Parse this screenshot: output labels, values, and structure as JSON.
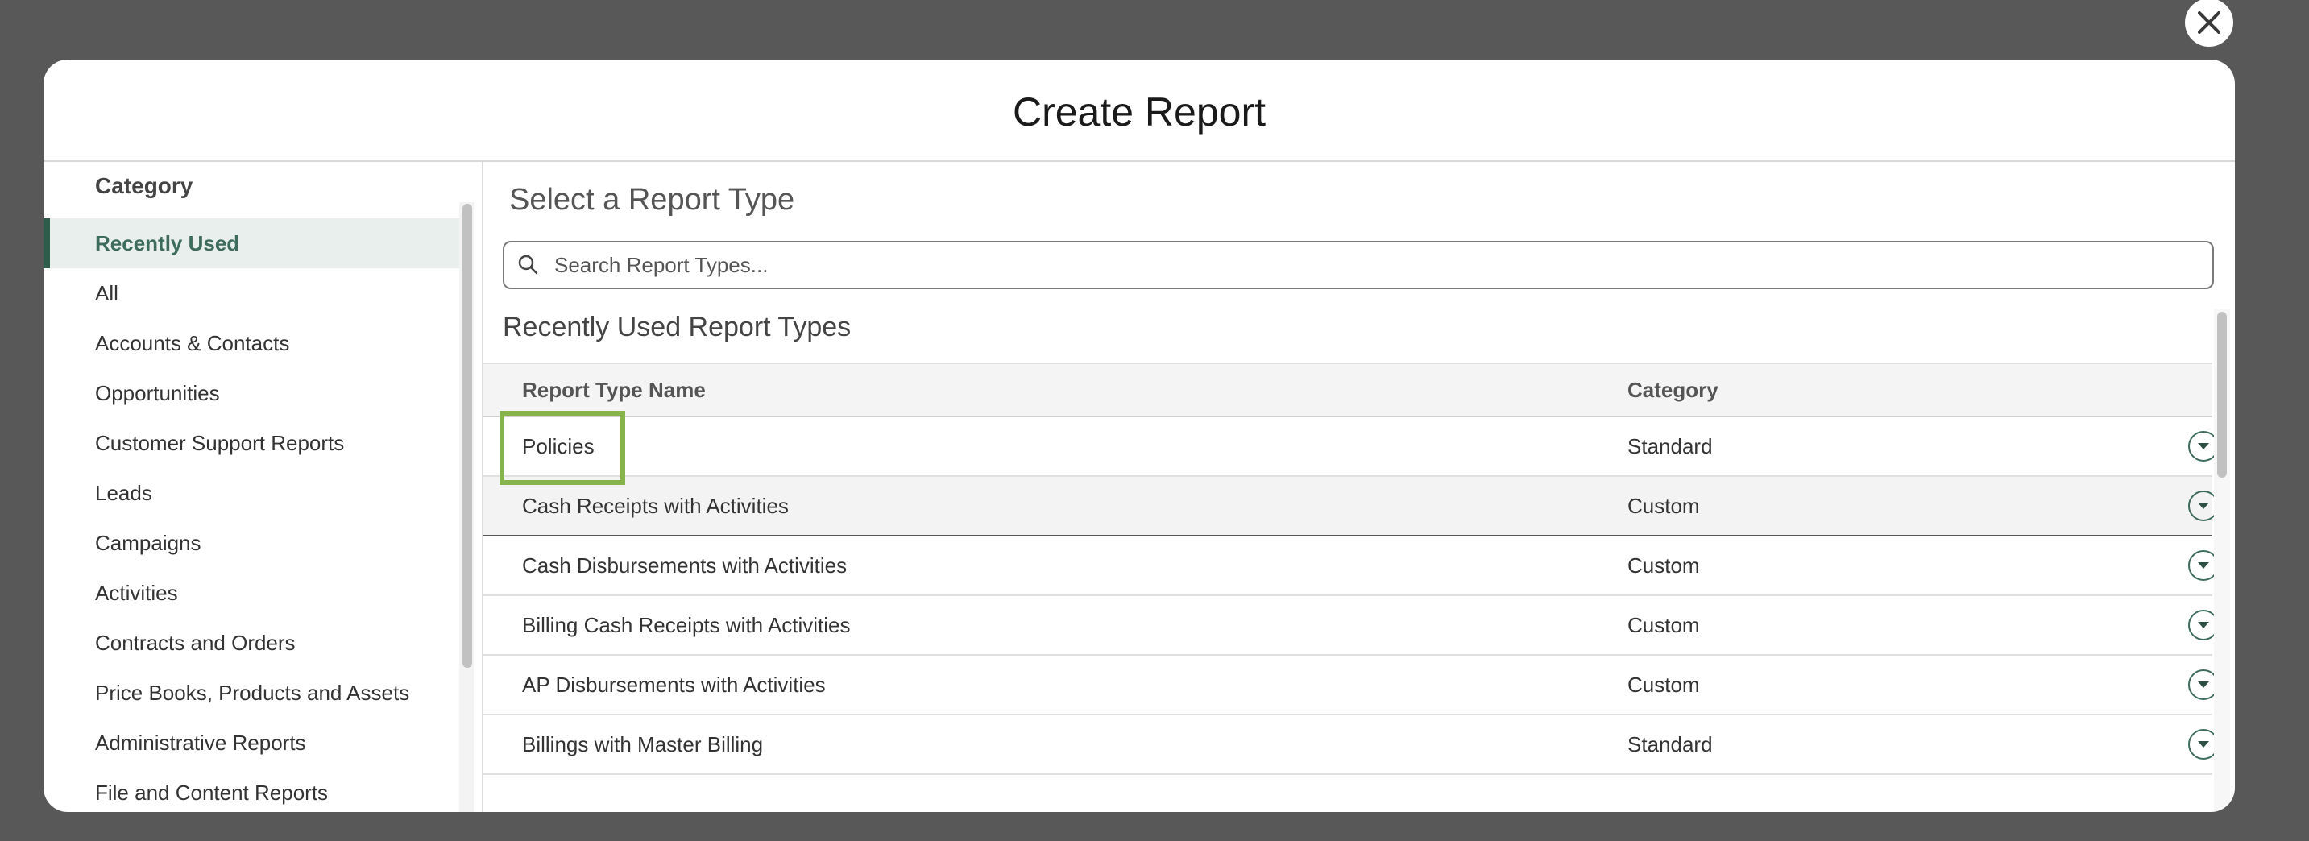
{
  "modal": {
    "title": "Create Report"
  },
  "categories": {
    "heading": "Category",
    "items": [
      "Recently Used",
      "All",
      "Accounts & Contacts",
      "Opportunities",
      "Customer Support Reports",
      "Leads",
      "Campaigns",
      "Activities",
      "Contracts and Orders",
      "Price Books, Products and Assets",
      "Administrative Reports",
      "File and Content Reports"
    ],
    "selected": "Recently Used"
  },
  "main": {
    "title": "Select a Report Type",
    "search_placeholder": "Search Report Types...",
    "section_title": "Recently Used Report Types",
    "columns": [
      "Report Type Name",
      "Category"
    ],
    "rows": [
      {
        "name": "Policies",
        "category": "Standard"
      },
      {
        "name": "Cash Receipts with Activities",
        "category": "Custom"
      },
      {
        "name": "Cash Disbursements with Activities",
        "category": "Custom"
      },
      {
        "name": "Billing Cash Receipts with Activities",
        "category": "Custom"
      },
      {
        "name": "AP Disbursements with Activities",
        "category": "Custom"
      },
      {
        "name": "Billings with Master Billing",
        "category": "Standard"
      }
    ],
    "highlighted_row": "Policies"
  },
  "icons": {
    "close": "close-icon",
    "search": "search-icon",
    "row_menu": "chevron-down-icon"
  },
  "colors": {
    "accent": "#2f5d4c",
    "highlight": "#86b44a",
    "overlay": "#585858"
  }
}
